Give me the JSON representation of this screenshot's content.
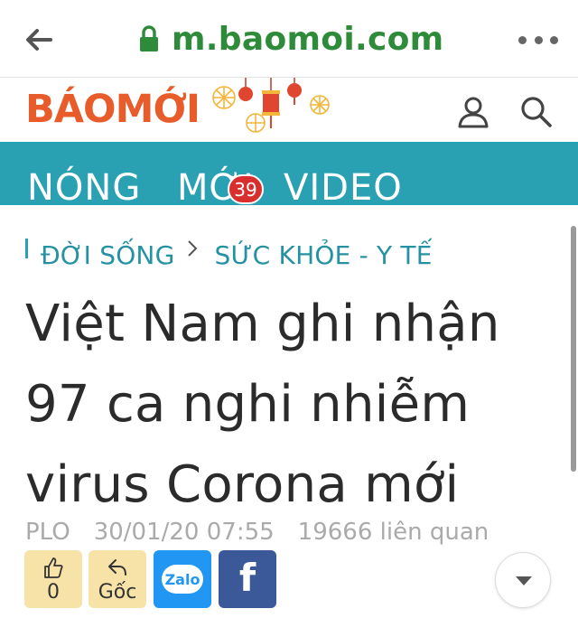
{
  "browser": {
    "url": "m.baomoi.com",
    "icons": [
      "back-arrow-icon",
      "lock-icon",
      "more-vert-icon"
    ]
  },
  "site": {
    "logo_text": "BÁOMỚI",
    "icons": [
      "user-icon",
      "search-icon",
      "lantern-decoration-icon"
    ]
  },
  "nav": {
    "items": [
      {
        "label": "NÓNG"
      },
      {
        "label": "MỚI"
      },
      {
        "label": "VIDEO"
      }
    ],
    "badge": "39",
    "bg_color": "#2aa1b3",
    "badge_color": "#d92e2e"
  },
  "breadcrumb": {
    "items": [
      "ĐỜI SỐNG",
      "SỨC KHỎE - Y TẾ"
    ]
  },
  "article": {
    "title": "Việt Nam ghi nhận 97 ca nghi nhiễm virus Corona mới",
    "source": "PLO",
    "datetime": "30/01/20 07:55",
    "related": "19666 liên quan"
  },
  "actions": {
    "like_count": "0",
    "source_label": "Gốc",
    "zalo_label": "Zalo",
    "facebook_label": "f",
    "like_color": "#f7e3a8",
    "zalo_color": "#2196f3",
    "facebook_color": "#3b5999"
  }
}
